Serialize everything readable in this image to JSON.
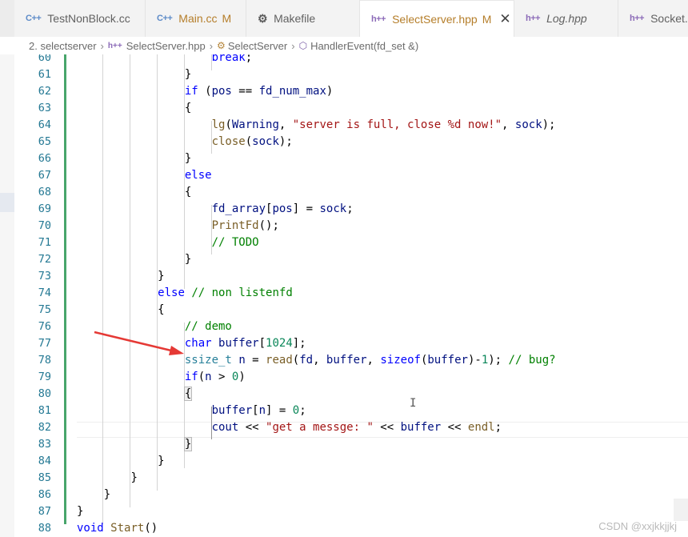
{
  "tabs": [
    {
      "icon": "C++",
      "label": "TestNonBlock.cc",
      "modified": "",
      "italic": false,
      "active": false
    },
    {
      "icon": "C++",
      "label": "Main.cc",
      "modified": "M",
      "italic": false,
      "active": false
    },
    {
      "icon": "makefile",
      "label": "Makefile",
      "modified": "",
      "italic": false,
      "active": false
    },
    {
      "icon": "h++",
      "label": "SelectServer.hpp",
      "modified": "M",
      "italic": false,
      "active": true
    },
    {
      "icon": "h++",
      "label": "Log.hpp",
      "modified": "",
      "italic": true,
      "active": false
    },
    {
      "icon": "h++",
      "label": "Socket.hpp",
      "modified": "",
      "italic": false,
      "active": false
    }
  ],
  "breadcrumb": {
    "folder": "2. selectserver",
    "file_icon": "h++",
    "file": "SelectServer.hpp",
    "class": "SelectServer",
    "method": "HandlerEvent(fd_set &)"
  },
  "editor": {
    "line_numbers": [
      "60",
      "61",
      "62",
      "63",
      "64",
      "65",
      "66",
      "67",
      "68",
      "69",
      "70",
      "71",
      "72",
      "73",
      "74",
      "75",
      "76",
      "77",
      "78",
      "79",
      "80",
      "81",
      "82",
      "83",
      "84",
      "85",
      "86",
      "87",
      "88"
    ],
    "lines": [
      {
        "indent": "                    ",
        "tokens": [
          {
            "t": "break",
            "c": "kw"
          },
          {
            "t": ";",
            "c": "pl"
          }
        ]
      },
      {
        "indent": "                ",
        "tokens": [
          {
            "t": "}",
            "c": "pl"
          }
        ]
      },
      {
        "indent": "                ",
        "tokens": [
          {
            "t": "if",
            "c": "kw"
          },
          {
            "t": " (",
            "c": "pl"
          },
          {
            "t": "pos",
            "c": "vr"
          },
          {
            "t": " == ",
            "c": "pl"
          },
          {
            "t": "fd_num_max",
            "c": "vr"
          },
          {
            "t": ")",
            "c": "pl"
          }
        ]
      },
      {
        "indent": "                ",
        "tokens": [
          {
            "t": "{",
            "c": "pl"
          }
        ]
      },
      {
        "indent": "                    ",
        "tokens": [
          {
            "t": "lg",
            "c": "fn"
          },
          {
            "t": "(",
            "c": "pl"
          },
          {
            "t": "Warning",
            "c": "vr"
          },
          {
            "t": ", ",
            "c": "pl"
          },
          {
            "t": "\"server is full, close %d now!\"",
            "c": "st"
          },
          {
            "t": ", ",
            "c": "pl"
          },
          {
            "t": "sock",
            "c": "vr"
          },
          {
            "t": ");",
            "c": "pl"
          }
        ]
      },
      {
        "indent": "                    ",
        "tokens": [
          {
            "t": "close",
            "c": "fn"
          },
          {
            "t": "(",
            "c": "pl"
          },
          {
            "t": "sock",
            "c": "vr"
          },
          {
            "t": ");",
            "c": "pl"
          }
        ]
      },
      {
        "indent": "                ",
        "tokens": [
          {
            "t": "}",
            "c": "pl"
          }
        ]
      },
      {
        "indent": "                ",
        "tokens": [
          {
            "t": "else",
            "c": "kw"
          }
        ]
      },
      {
        "indent": "                ",
        "tokens": [
          {
            "t": "{",
            "c": "pl"
          }
        ]
      },
      {
        "indent": "                    ",
        "tokens": [
          {
            "t": "fd_array",
            "c": "vr"
          },
          {
            "t": "[",
            "c": "pl"
          },
          {
            "t": "pos",
            "c": "vr"
          },
          {
            "t": "] = ",
            "c": "pl"
          },
          {
            "t": "sock",
            "c": "vr"
          },
          {
            "t": ";",
            "c": "pl"
          }
        ]
      },
      {
        "indent": "                    ",
        "tokens": [
          {
            "t": "PrintFd",
            "c": "fn"
          },
          {
            "t": "();",
            "c": "pl"
          }
        ]
      },
      {
        "indent": "                    ",
        "tokens": [
          {
            "t": "// TODO",
            "c": "cm"
          }
        ]
      },
      {
        "indent": "                ",
        "tokens": [
          {
            "t": "}",
            "c": "pl"
          }
        ]
      },
      {
        "indent": "            ",
        "tokens": [
          {
            "t": "}",
            "c": "pl"
          }
        ]
      },
      {
        "indent": "            ",
        "tokens": [
          {
            "t": "else",
            "c": "kw"
          },
          {
            "t": " ",
            "c": "pl"
          },
          {
            "t": "// non listenfd",
            "c": "cm"
          }
        ]
      },
      {
        "indent": "            ",
        "tokens": [
          {
            "t": "{",
            "c": "pl"
          }
        ]
      },
      {
        "indent": "                ",
        "tokens": [
          {
            "t": "// demo",
            "c": "cm"
          }
        ]
      },
      {
        "indent": "                ",
        "tokens": [
          {
            "t": "char",
            "c": "kw"
          },
          {
            "t": " ",
            "c": "pl"
          },
          {
            "t": "buffer",
            "c": "vr"
          },
          {
            "t": "[",
            "c": "pl"
          },
          {
            "t": "1024",
            "c": "nm"
          },
          {
            "t": "];",
            "c": "pl"
          }
        ]
      },
      {
        "indent": "                ",
        "tokens": [
          {
            "t": "ssize_t",
            "c": "ty"
          },
          {
            "t": " ",
            "c": "pl"
          },
          {
            "t": "n",
            "c": "vr"
          },
          {
            "t": " = ",
            "c": "pl"
          },
          {
            "t": "read",
            "c": "fn"
          },
          {
            "t": "(",
            "c": "pl"
          },
          {
            "t": "fd",
            "c": "vr"
          },
          {
            "t": ", ",
            "c": "pl"
          },
          {
            "t": "buffer",
            "c": "vr"
          },
          {
            "t": ", ",
            "c": "pl"
          },
          {
            "t": "sizeof",
            "c": "kw"
          },
          {
            "t": "(",
            "c": "pl"
          },
          {
            "t": "buffer",
            "c": "vr"
          },
          {
            "t": ")-",
            "c": "pl"
          },
          {
            "t": "1",
            "c": "nm"
          },
          {
            "t": "); ",
            "c": "pl"
          },
          {
            "t": "// bug?",
            "c": "cm"
          }
        ]
      },
      {
        "indent": "                ",
        "tokens": [
          {
            "t": "if",
            "c": "kw"
          },
          {
            "t": "(",
            "c": "pl"
          },
          {
            "t": "n",
            "c": "vr"
          },
          {
            "t": " > ",
            "c": "pl"
          },
          {
            "t": "0",
            "c": "nm"
          },
          {
            "t": ")",
            "c": "pl"
          }
        ]
      },
      {
        "indent": "                ",
        "tokens": [
          {
            "t": "{",
            "c": "pl",
            "match": true
          }
        ]
      },
      {
        "indent": "                    ",
        "tokens": [
          {
            "t": "buffer",
            "c": "vr"
          },
          {
            "t": "[",
            "c": "pl"
          },
          {
            "t": "n",
            "c": "vr"
          },
          {
            "t": "] = ",
            "c": "pl"
          },
          {
            "t": "0",
            "c": "nm"
          },
          {
            "t": ";",
            "c": "pl"
          }
        ]
      },
      {
        "indent": "                    ",
        "tokens": [
          {
            "t": "cout",
            "c": "vr"
          },
          {
            "t": " << ",
            "c": "pl"
          },
          {
            "t": "\"get a messge: \"",
            "c": "st"
          },
          {
            "t": " << ",
            "c": "pl"
          },
          {
            "t": "buffer",
            "c": "vr"
          },
          {
            "t": " << ",
            "c": "pl"
          },
          {
            "t": "endl",
            "c": "fn"
          },
          {
            "t": ";",
            "c": "pl"
          }
        ]
      },
      {
        "indent": "                ",
        "tokens": [
          {
            "t": "}",
            "c": "pl",
            "match": true
          }
        ]
      },
      {
        "indent": "            ",
        "tokens": [
          {
            "t": "}",
            "c": "pl"
          }
        ]
      },
      {
        "indent": "        ",
        "tokens": [
          {
            "t": "}",
            "c": "pl"
          }
        ]
      },
      {
        "indent": "    ",
        "tokens": [
          {
            "t": "}",
            "c": "pl"
          }
        ]
      },
      {
        "indent": "",
        "tokens": [
          {
            "t": "}",
            "c": "pl"
          }
        ]
      },
      {
        "indent": "",
        "tokens": [
          {
            "t": "void",
            "c": "kw"
          },
          {
            "t": " ",
            "c": "pl"
          },
          {
            "t": "Start",
            "c": "fn"
          },
          {
            "t": "()",
            "c": "pl"
          }
        ]
      }
    ],
    "text_cursor": "I"
  },
  "annotation": {
    "arrow_color": "#e53935"
  },
  "watermark": "CSDN @xxjkkjjkj"
}
